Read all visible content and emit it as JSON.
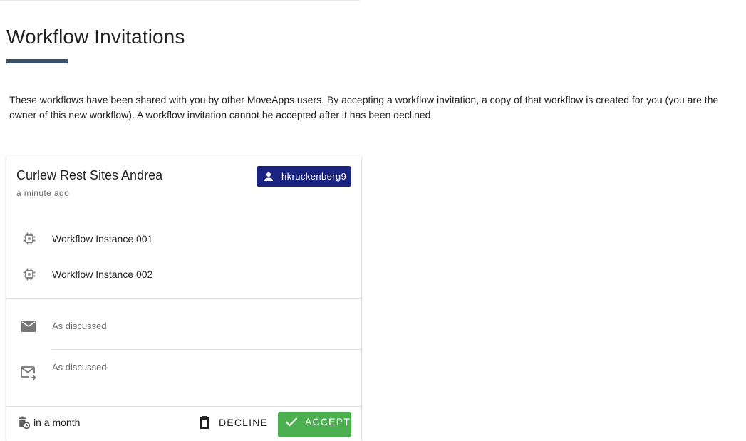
{
  "page": {
    "title": "Workflow Invitations",
    "intro": "These workflows have been shared with you by other MoveApps users. By accepting a workflow invitation, a copy of that workflow is created for you (you are the owner of this new workflow). A workflow invitation cannot be accepted after it has been declined."
  },
  "colors": {
    "title_underline": "#3b4e66",
    "user_chip": "#1a237e",
    "accept_button": "#4caf50"
  },
  "invitation": {
    "workflow_name": "Curlew Rest Sites Andrea",
    "shared_time": "a minute ago",
    "sender": {
      "username": "hkruckenberg9",
      "icon": "person-icon"
    },
    "instances": [
      {
        "label": "Workflow Instance 001",
        "icon": "chip-icon"
      },
      {
        "label": "Workflow Instance 002",
        "icon": "chip-icon"
      }
    ],
    "messages": [
      {
        "text": "As discussed",
        "icon": "mail-icon"
      },
      {
        "text": "As discussed",
        "icon": "mail-sent-icon"
      }
    ],
    "expiry": {
      "text": "in a month",
      "icon": "delete-clock-icon"
    },
    "actions": {
      "decline_label": "DECLINE",
      "decline_icon": "trash-icon",
      "accept_label": "ACCEPT",
      "accept_icon": "check-icon"
    }
  }
}
